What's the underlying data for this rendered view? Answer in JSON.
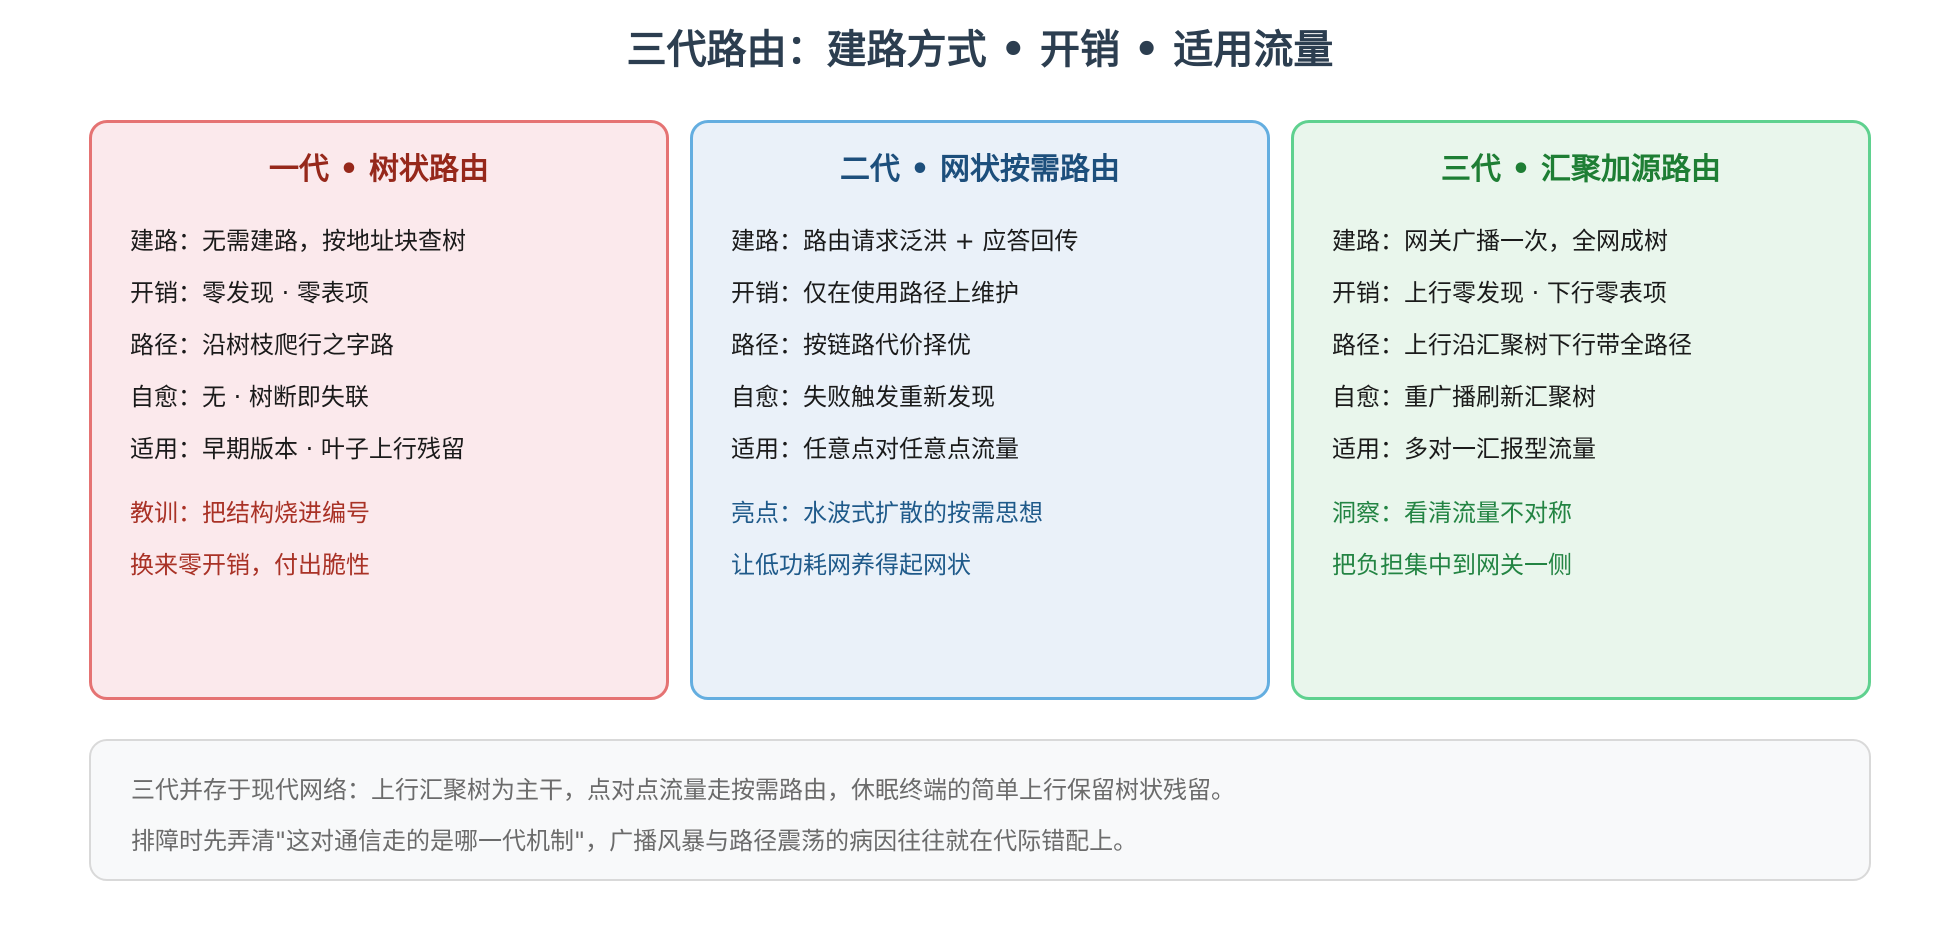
{
  "title": "三代路由：建路方式 • 开销 • 适用流量",
  "cards": [
    {
      "title": "一代 • 树状路由",
      "rows": [
        "建路：无需建路，按地址块查树",
        "开销：零发现 · 零表项",
        "路径：沿树枝爬行之字路",
        "自愈：无 · 树断即失联",
        "适用：早期版本 · 叶子上行残留"
      ],
      "notes": [
        "教训：把结构烧进编号",
        "换来零开销，付出脆性"
      ]
    },
    {
      "title": "二代 • 网状按需路由",
      "rows": [
        "建路：路由请求泛洪 + 应答回传",
        "开销：仅在使用路径上维护",
        "路径：按链路代价择优",
        "自愈：失败触发重新发现",
        "适用：任意点对任意点流量"
      ],
      "notes": [
        "亮点：水波式扩散的按需思想",
        "让低功耗网养得起网状"
      ]
    },
    {
      "title": "三代 • 汇聚加源路由",
      "rows": [
        "建路：网关广播一次，全网成树",
        "开销：上行零发现 · 下行零表项",
        "路径：上行沿汇聚树下行带全路径",
        "自愈：重广播刷新汇聚树",
        "适用：多对一汇报型流量"
      ],
      "notes": [
        "洞察：看清流量不对称",
        "把负担集中到网关一侧"
      ]
    }
  ],
  "footer": {
    "line1": "三代并存于现代网络：上行汇聚树为主干，点对点流量走按需路由，休眠终端的简单上行保留树状残留。",
    "line2": "排障时先弄清\"这对通信走的是哪一代机制\"，广播风暴与路径震荡的病因往往就在代际错配上。"
  },
  "colors": {
    "card1_bg": "#fbe9ec",
    "card1_border": "#e57373",
    "card2_bg": "#eaf1f9",
    "card2_border": "#64aee0",
    "card3_bg": "#e9f6ec",
    "card3_border": "#5fd18f"
  }
}
